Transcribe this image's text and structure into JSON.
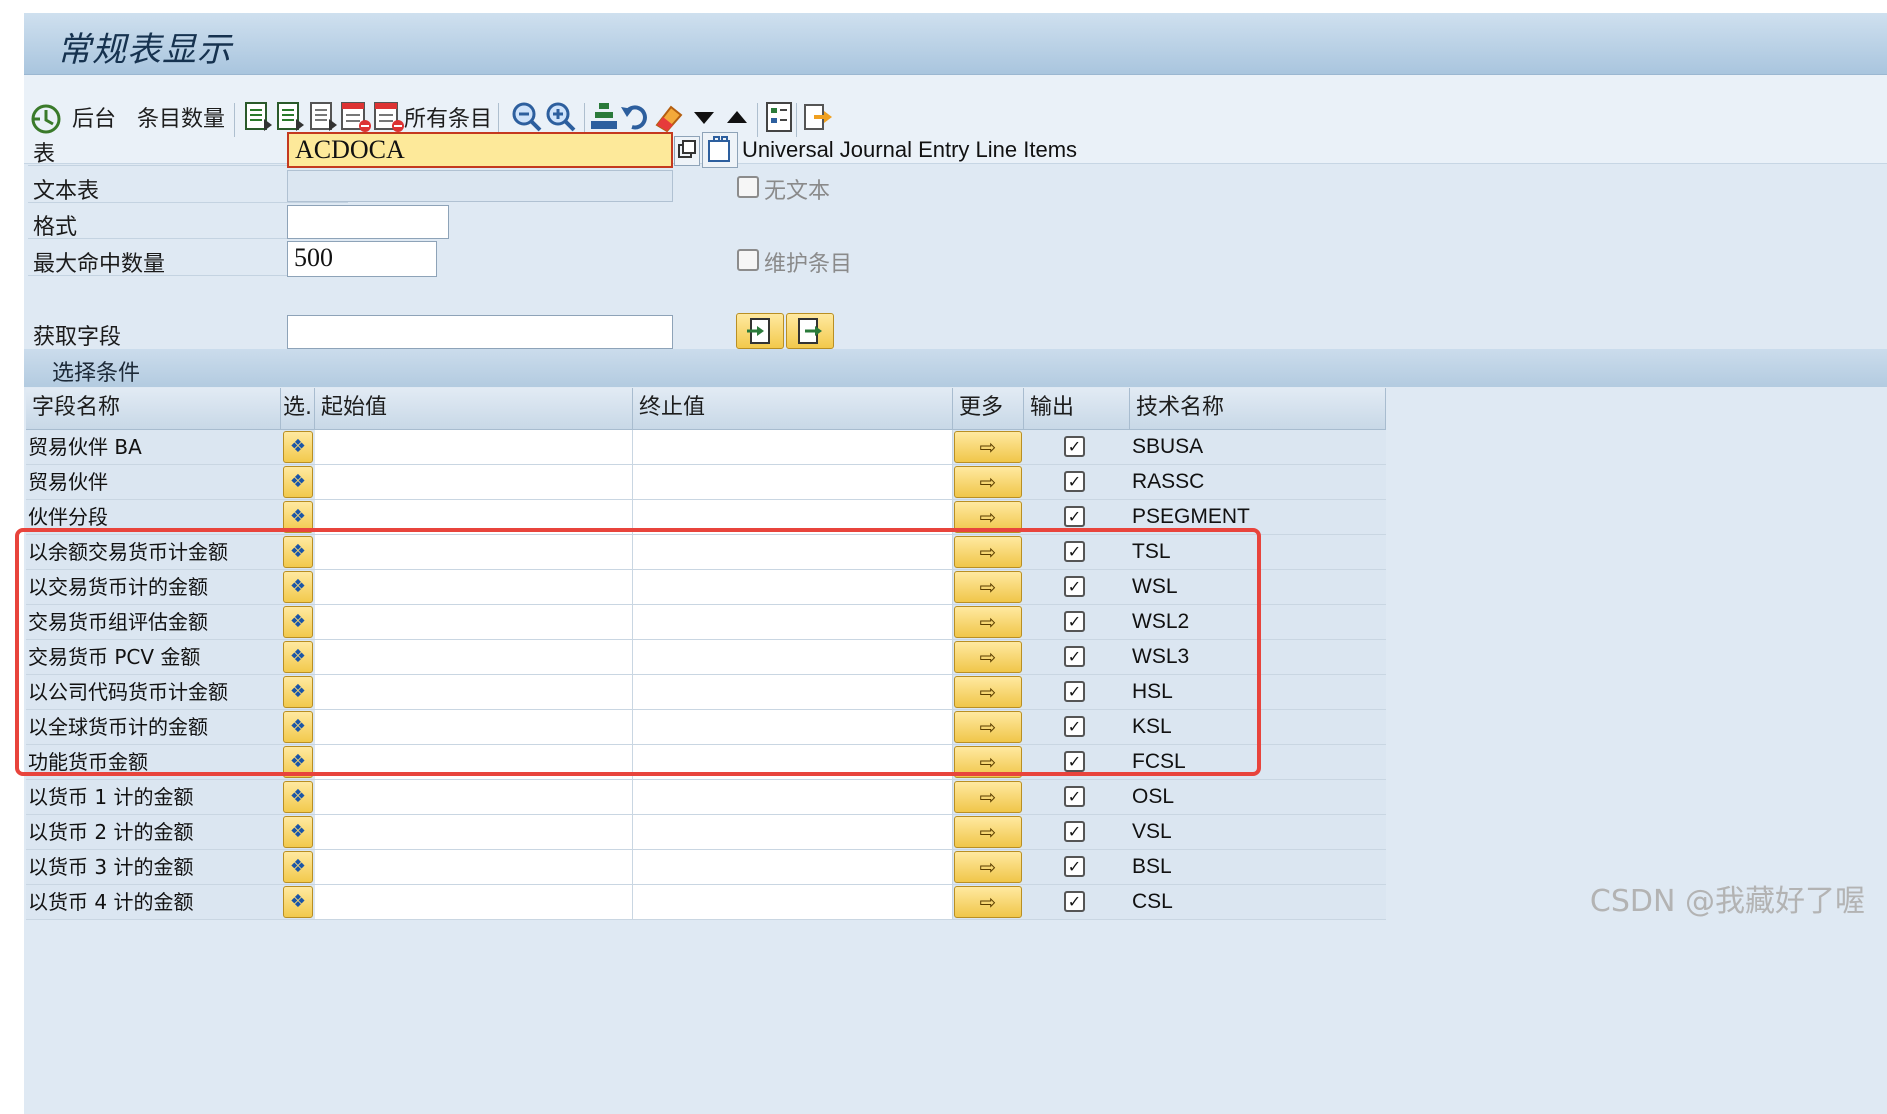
{
  "window": {
    "title": "常规表显示"
  },
  "toolbar": {
    "background_label": "后台",
    "entry_count_label": "条目数量",
    "all_entries_label": "所有条目"
  },
  "form": {
    "table_label": "表",
    "table_value": "ACDOCA",
    "table_description": "Universal Journal Entry Line Items",
    "text_table_label": "文本表",
    "no_text_label": "无文本",
    "format_label": "格式",
    "max_hits_label": "最大命中数量",
    "max_hits_value": "500",
    "maintain_entries_label": "维护条目",
    "get_fields_label": "获取字段"
  },
  "selection": {
    "header": "选择条件",
    "columns": {
      "field_name": "字段名称",
      "sel": "选.",
      "from": "起始值",
      "to": "终止值",
      "more": "更多",
      "output": "输出",
      "tech_name": "技术名称"
    },
    "rows": [
      {
        "name": "贸易伙伴 BA",
        "tech": "SBUSA"
      },
      {
        "name": "贸易伙伴",
        "tech": "RASSC"
      },
      {
        "name": "伙伴分段",
        "tech": "PSEGMENT"
      },
      {
        "name": "以余额交易货币计金额",
        "tech": "TSL"
      },
      {
        "name": "以交易货币计的金额",
        "tech": "WSL"
      },
      {
        "name": "交易货币组评估金额",
        "tech": "WSL2"
      },
      {
        "name": "交易货币 PCV 金额",
        "tech": "WSL3"
      },
      {
        "name": "以公司代码货币计金额",
        "tech": "HSL"
      },
      {
        "name": "以全球货币计的金额",
        "tech": "KSL"
      },
      {
        "name": "功能货币金额",
        "tech": "FCSL"
      },
      {
        "name": "以货币 1 计的金额",
        "tech": "OSL"
      },
      {
        "name": "以货币 2 计的金额",
        "tech": "VSL"
      },
      {
        "name": "以货币 3 计的金额",
        "tech": "BSL"
      },
      {
        "name": "以货币 4 计的金额",
        "tech": "CSL"
      }
    ]
  },
  "watermark": "CSDN @我藏好了喔",
  "colors": {
    "highlight_box": "#e8443c",
    "input_focus": "#fde99a"
  }
}
